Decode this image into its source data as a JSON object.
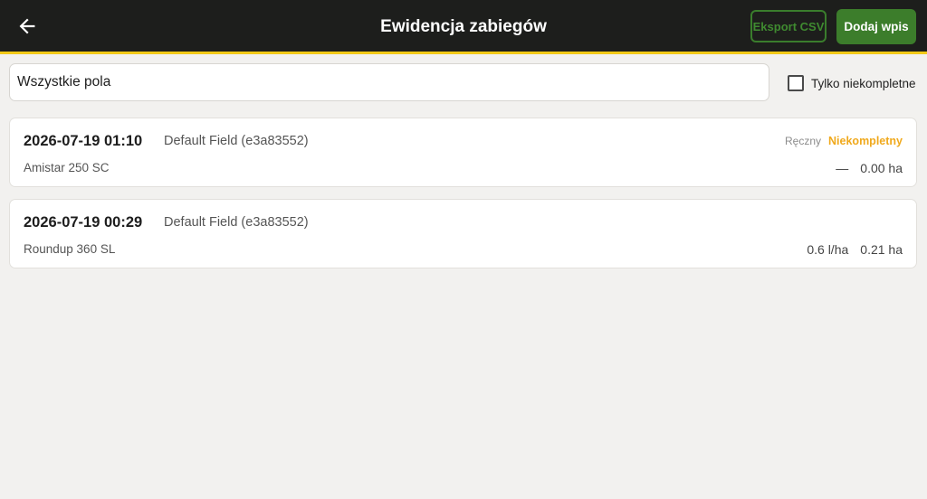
{
  "header": {
    "title": "Ewidencja zabiegów",
    "export_label": "Eksport CSV",
    "add_label": "Dodaj wpis"
  },
  "filter": {
    "field_value": "Wszystkie pola",
    "incomplete_only_label": "Tylko niekompletne",
    "incomplete_only_checked": false
  },
  "records": [
    {
      "datetime": "2026-07-19 01:10",
      "field": "Default Field (e3a83552)",
      "product": "Amistar 250 SC",
      "source": "Ręczny",
      "status": "Niekompletny",
      "dose": "—",
      "area": "0.00 ha"
    },
    {
      "datetime": "2026-07-19 00:29",
      "field": "Default Field (e3a83552)",
      "product": "Roundup 360 SL",
      "dose": "0.6 l/ha",
      "area": "0.21 ha"
    }
  ],
  "colors": {
    "appbar": "#1d1e1c",
    "accent_yellow": "#f2c918",
    "primary_green": "#3c7d2b",
    "status_incomplete": "#f0a91c"
  },
  "icons": {
    "back": "arrow-left-icon"
  }
}
